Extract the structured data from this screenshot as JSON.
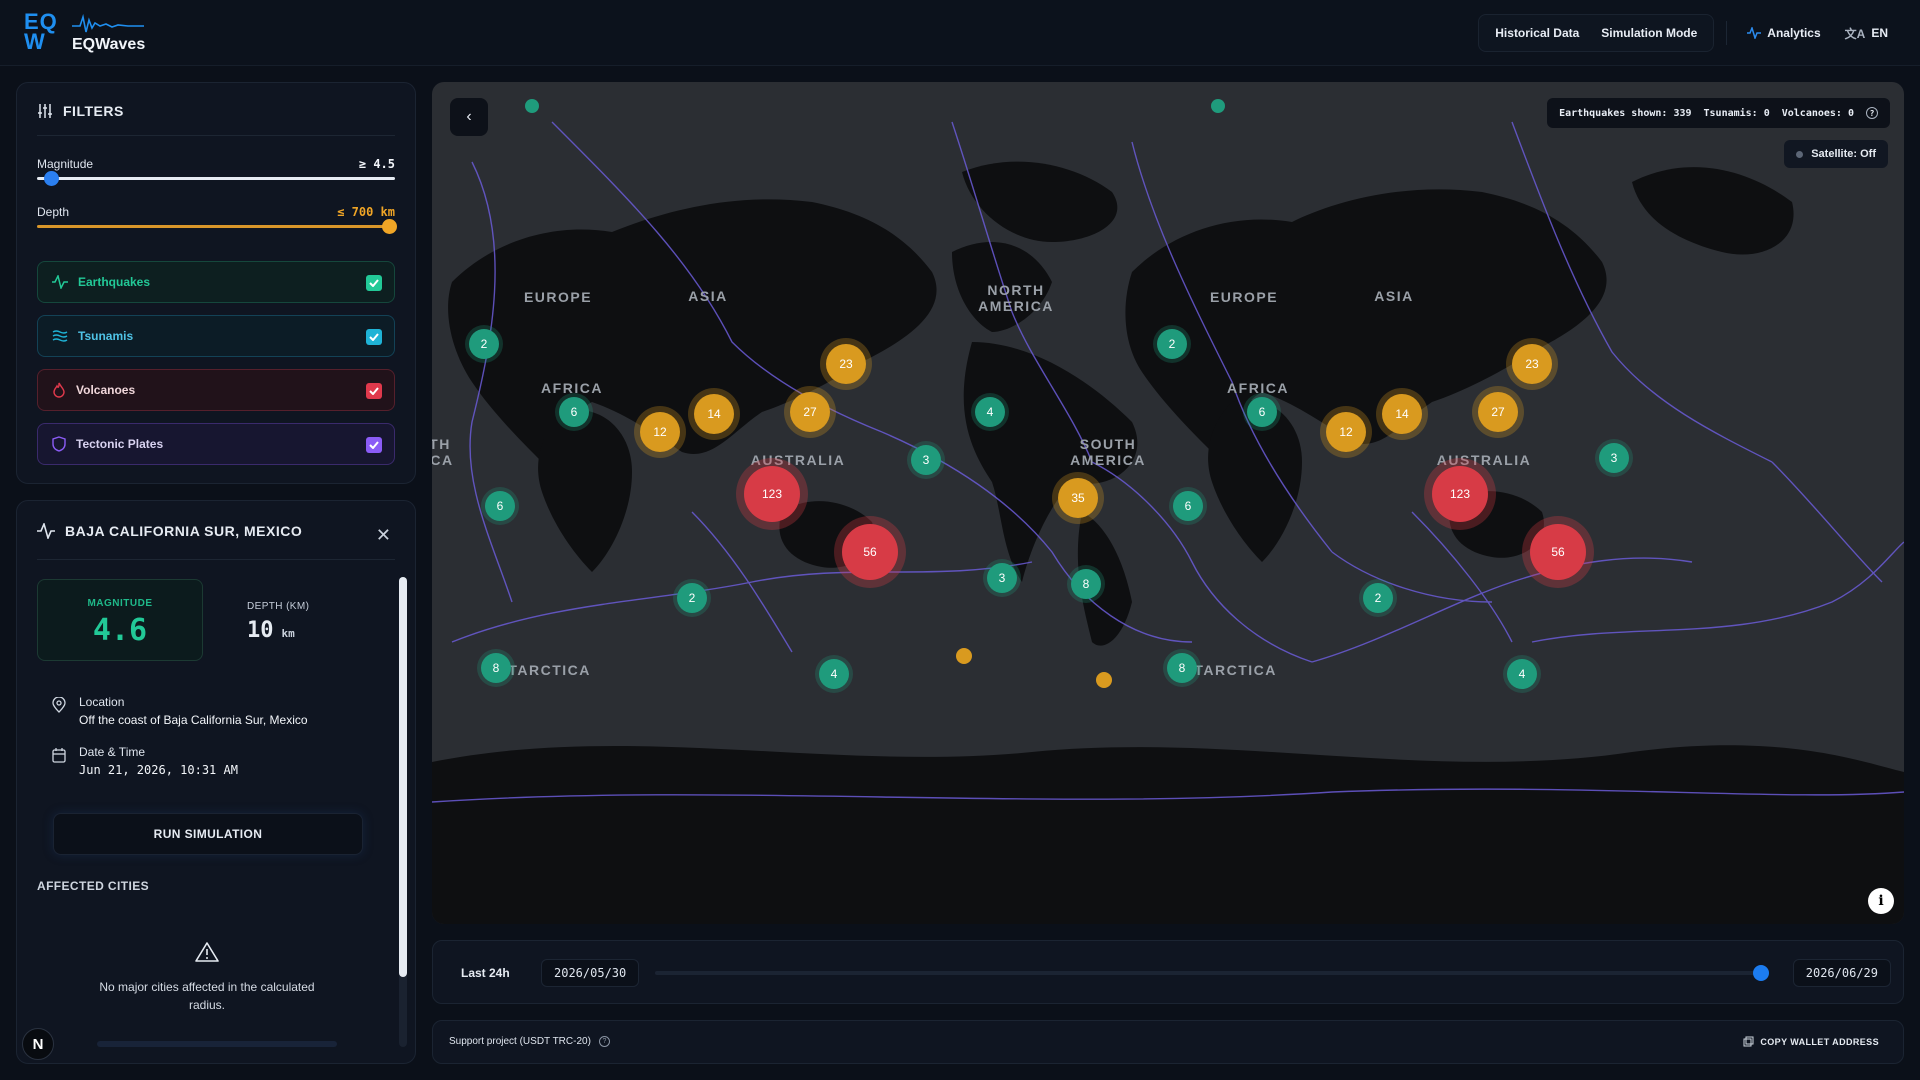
{
  "app": {
    "logo_mark_line1": "EQ",
    "logo_mark_line2": "W",
    "name": "EQWaves"
  },
  "nav": {
    "historical": "Historical Data",
    "simulation": "Simulation Mode",
    "analytics": "Analytics",
    "language": "EN"
  },
  "filters": {
    "title": "FILTERS",
    "magnitude_label": "Magnitude",
    "magnitude_value": "≥ 4.5",
    "magnitude_level": 0.02,
    "depth_label": "Depth",
    "depth_value": "≤ 700 km",
    "depth_level": 1.0,
    "toggles": [
      {
        "label": "Earthquakes",
        "checked": true,
        "color": "#22c997"
      },
      {
        "label": "Tsunamis",
        "checked": true,
        "color": "#1fb3d6"
      },
      {
        "label": "Volcanoes",
        "checked": true,
        "color": "#e0394c"
      },
      {
        "label": "Tectonic Plates",
        "checked": true,
        "color": "#8b5cf6"
      }
    ]
  },
  "detail": {
    "title": "BAJA CALIFORNIA SUR, MEXICO",
    "magnitude_label": "MAGNITUDE",
    "magnitude": "4.6",
    "depth_label": "DEPTH (KM)",
    "depth": "10",
    "depth_unit": "km",
    "location_label": "Location",
    "location": "Off the coast of Baja California Sur, Mexico",
    "datetime_label": "Date & Time",
    "datetime": "Jun 21, 2026, 10:31 AM",
    "run_button": "RUN SIMULATION",
    "affected_title": "AFFECTED CITIES",
    "no_cities_line1": "No major cities affected in the calculated",
    "no_cities_line2": "radius."
  },
  "map": {
    "stats_earthquakes": "Earthquakes shown: 339",
    "stats_tsunamis": "Tsunamis: 0",
    "stats_volcanoes": "Volcanoes: 0",
    "satellite": "Satellite: Off",
    "regions": [
      "EUROPE",
      "ASIA",
      "AFRICA",
      "AUSTRALIA",
      "NORTH",
      "AMERICA",
      "SOUTH",
      "AMERICA",
      "ANTARCTICA",
      "EUROPE",
      "ASIA",
      "AFRICA",
      "AUSTRALIA",
      "ANTARCTICA",
      "TH",
      "CA"
    ],
    "clusters": [
      "2",
      "6",
      "12",
      "14",
      "23",
      "27",
      "123",
      "56",
      "6",
      "2",
      "8",
      "4",
      "4",
      "3",
      "3",
      "35",
      "8",
      "6",
      "8",
      "2",
      "6",
      "12",
      "14",
      "27",
      "23",
      "123",
      "56",
      "2",
      "4",
      "3"
    ]
  },
  "timeline": {
    "range_button": "Last 24h",
    "start_date": "2026/05/30",
    "end_date": "2026/06/29",
    "position": 0.99
  },
  "footer": {
    "support": "Support project (USDT TRC-20)",
    "wallet": "COPY WALLET ADDRESS"
  }
}
